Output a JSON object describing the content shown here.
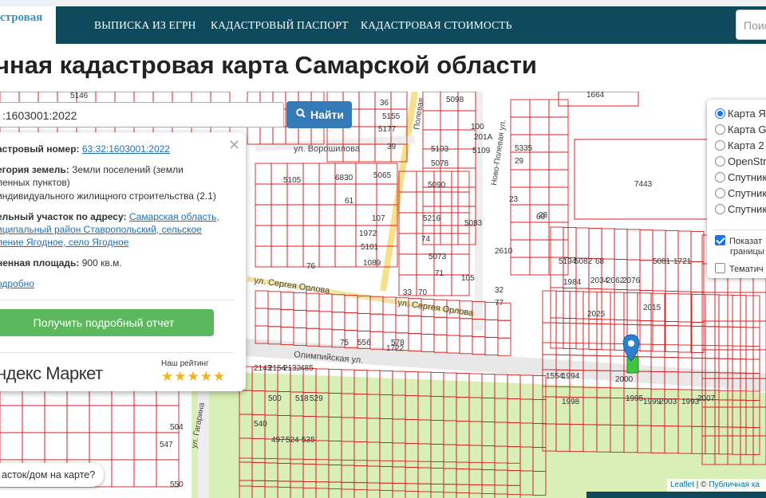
{
  "header": {
    "logo_text": "стровая",
    "nav": [
      "ВЫПИСКА ИЗ ЕГРН",
      "КАДАСТРОВЫЙ ПАСПОРТ",
      "КАДАСТРОВАЯ СТОИМОСТЬ"
    ],
    "search_placeholder": "Поис"
  },
  "page_title": "чная кадастровая карта Самарской области",
  "map_search": {
    "value": ":1603001:2022",
    "button_label": "Найти"
  },
  "popup": {
    "cad_number_label": "астровый номер:",
    "cad_number_value": "63:32:1603001:2022",
    "land_cat_label": "егория земель:",
    "land_cat_value_1": "Земли поселений (земли",
    "land_cat_value_2": "ленных пунктов)",
    "land_use": "индивидуального жилищного строительства (2.1)",
    "address_label": "ельный участок по адресу:",
    "address_1": "Самарская область,",
    "address_2": "иципальный район Ставропольский, сельское",
    "address_3": "ление Ягодное, село Ягодное",
    "area_label": "ненная площадь:",
    "area_value": "900 кв.м.",
    "more_link": "одробно",
    "report_button": "Получить подробный отчет",
    "ym_brand": "ндекс Маркет",
    "rating_label": "Наш рейтинг",
    "stars": "★★★★★"
  },
  "layers": {
    "options": [
      "Карта Я",
      "Карта G",
      "Карта 2",
      "OpenStr",
      "Спутник",
      "Спутник",
      "Спутник"
    ],
    "selected_index": 0,
    "checks": [
      {
        "label_1": "Показат",
        "label_2": "границы",
        "checked": true
      },
      {
        "label_1": "Тематич",
        "checked": false
      }
    ]
  },
  "where_button": "асток/дом на карте?",
  "attribution": {
    "leaflet": "Leaflet",
    "sep": " | © ",
    "source": "Публичная ка"
  },
  "streets": [
    "ул. Ворошилова",
    "ул. Сергея Орлова",
    "ул. Сергея Орлова",
    "Олимпийская ул.",
    "Ново-Полевая ул.",
    "Полевая",
    "ул. Гагарина"
  ],
  "parcels": [
    "5146",
    "36",
    "5098",
    "1664",
    "5155",
    "5177",
    "100",
    "201А",
    "39",
    "5103",
    "5109",
    "5335",
    "5078",
    "29",
    "6830",
    "5065",
    "5090",
    "23",
    "5105",
    "61",
    "107",
    "5216",
    "28",
    "69",
    "7443",
    "1972",
    "74",
    "5083",
    "5101",
    "5073",
    "2610",
    "1089",
    "76",
    "33",
    "70",
    "71",
    "105",
    "32",
    "77",
    "75",
    "1722",
    "1554",
    "1994",
    "1998",
    "2000",
    "1995",
    "1999",
    "2003",
    "1993",
    "2007",
    "2025",
    "2015",
    "1984",
    "2034",
    "2062",
    "2076",
    "2143",
    "2154",
    "2132",
    "485",
    "500",
    "518",
    "529",
    "540",
    "497",
    "524",
    "535",
    "547",
    "504",
    "550",
    "556",
    "578",
    "5194",
    "5082",
    "68",
    "5081",
    "1721",
    "1703",
    "1705",
    "1986",
    "1989",
    "2021",
    "1961",
    "1940",
    "2030",
    "2123",
    "2134"
  ]
}
